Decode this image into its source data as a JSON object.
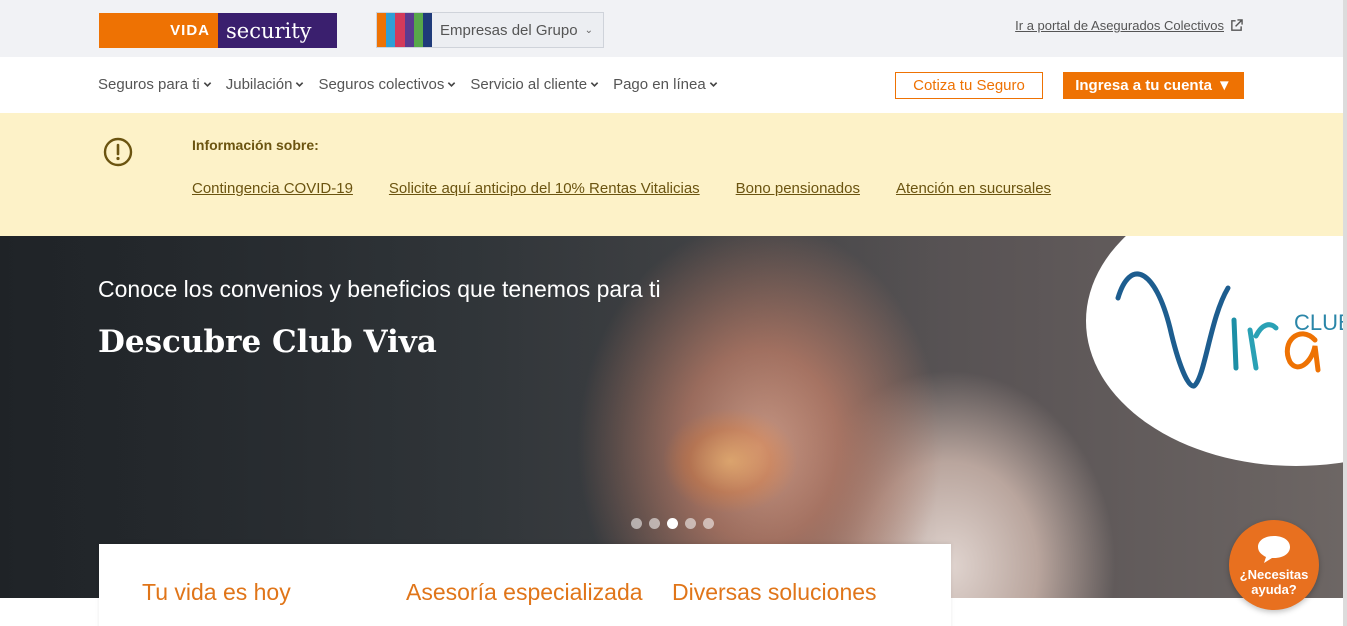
{
  "brand": {
    "vida": "VIDA",
    "security": "security"
  },
  "group_selector": {
    "label": "Empresas del Grupo",
    "stripe_colors": [
      "#ee7203",
      "#2f9fd6",
      "#d33a5a",
      "#5b3b8f",
      "#58a84a",
      "#1f3b7a"
    ]
  },
  "portal_link": {
    "label": "Ir a portal de Asegurados Colectivos"
  },
  "nav": {
    "items": [
      {
        "label": "Seguros para ti"
      },
      {
        "label": "Jubilación"
      },
      {
        "label": "Seguros colectivos"
      },
      {
        "label": "Servicio al cliente"
      },
      {
        "label": "Pago en línea"
      }
    ],
    "cotiza_label": "Cotiza tu Seguro",
    "ingresa_label": "Ingresa a tu cuenta"
  },
  "info": {
    "title": "Información sobre:",
    "links": [
      {
        "label": "Contingencia COVID-19"
      },
      {
        "label": "Solicite aquí anticipo del 10% Rentas Vitalicias"
      },
      {
        "label": "Bono pensionados"
      },
      {
        "label": "Atención en sucursales"
      }
    ]
  },
  "hero": {
    "subtitle": "Conoce los convenios y beneficios que tenemos para ti",
    "title": "Descubre Club Viva",
    "badge_club": "CLUB",
    "carousel": {
      "count": 5,
      "active": 3
    }
  },
  "cards": [
    {
      "title": "Tu vida es hoy"
    },
    {
      "title": "Asesoría especializada"
    },
    {
      "title": "Diversas soluciones"
    }
  ],
  "help": {
    "line1": "¿Necesitas",
    "line2": "ayuda?"
  },
  "colors": {
    "accent": "#ee7203",
    "brand_purple": "#3a1f6e",
    "info_bg": "#fdf2c8",
    "info_text": "#6b5410"
  }
}
